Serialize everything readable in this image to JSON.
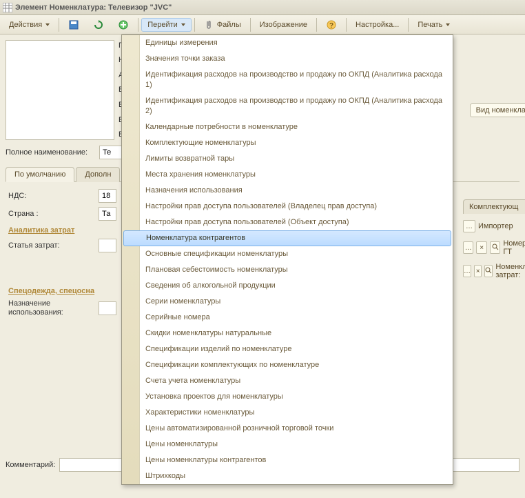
{
  "window": {
    "title": "Элемент Номенклатура: Телевизор \"JVC\""
  },
  "toolbar": {
    "actions": "Действия",
    "go": "Перейти",
    "files": "Файлы",
    "image": "Изображение",
    "settings": "Настройка...",
    "print": "Печать"
  },
  "form": {
    "labels": {
      "group": "Гр",
      "name": "На",
      "article": "Ар",
      "base": "Ба",
      "ed1": "Ед",
      "ed2": "Ед",
      "ed3": "Ед",
      "full_name": "Полное наименование:"
    },
    "full_name_value": "Те",
    "view_button": "Вид номенкла"
  },
  "tabs": {
    "default": "По умолчанию",
    "additional": "Дополн",
    "kit": "Комплектующ"
  },
  "panel": {
    "nds_label": "НДС:",
    "nds_value": "18",
    "country_label": "Страна :",
    "country_value": "Та",
    "cost_section": "Аналитика затрат",
    "cost_item_label": "Статья затрат:",
    "spec_section": "Спецодежда, спецосна",
    "usage_label": "Назначение использования:"
  },
  "right": {
    "importer": "Импортер",
    "gtd": "Номер ГТ",
    "nom_cost": "Номенкла затрат:"
  },
  "comment_label": "Комментарий:",
  "menu": {
    "items": [
      "Единицы измерения",
      "Значения точки заказа",
      "Идентификация расходов на производство и продажу по ОКПД (Аналитика расхода 1)",
      "Идентификация расходов на производство и продажу по ОКПД (Аналитика расхода 2)",
      "Календарные потребности в номенклатуре",
      "Комплектующие номенклатуры",
      "Лимиты возвратной тары",
      "Места хранения номенклатуры",
      "Назначения использования",
      "Настройки прав доступа пользователей (Владелец прав доступа)",
      "Настройки прав доступа пользователей (Объект доступа)",
      "Номенклатура контрагентов",
      "Основные спецификации номенклатуры",
      "Плановая себестоимость номенклатуры",
      "Сведения об алкогольной продукции",
      "Серии номенклатуры",
      "Серийные номера",
      "Скидки номенклатуры натуральные",
      "Спецификации изделий по номенклатуре",
      "Спецификации комплектующих по номенклатуре",
      "Счета учета номенклатуры",
      "Установка проектов для номенклатуры",
      "Характеристики номенклатуры",
      "Цены автоматизированной розничной торговой точки",
      "Цены номенклатуры",
      "Цены номенклатуры контрагентов",
      "Штрихкоды"
    ],
    "selected_index": 11
  }
}
